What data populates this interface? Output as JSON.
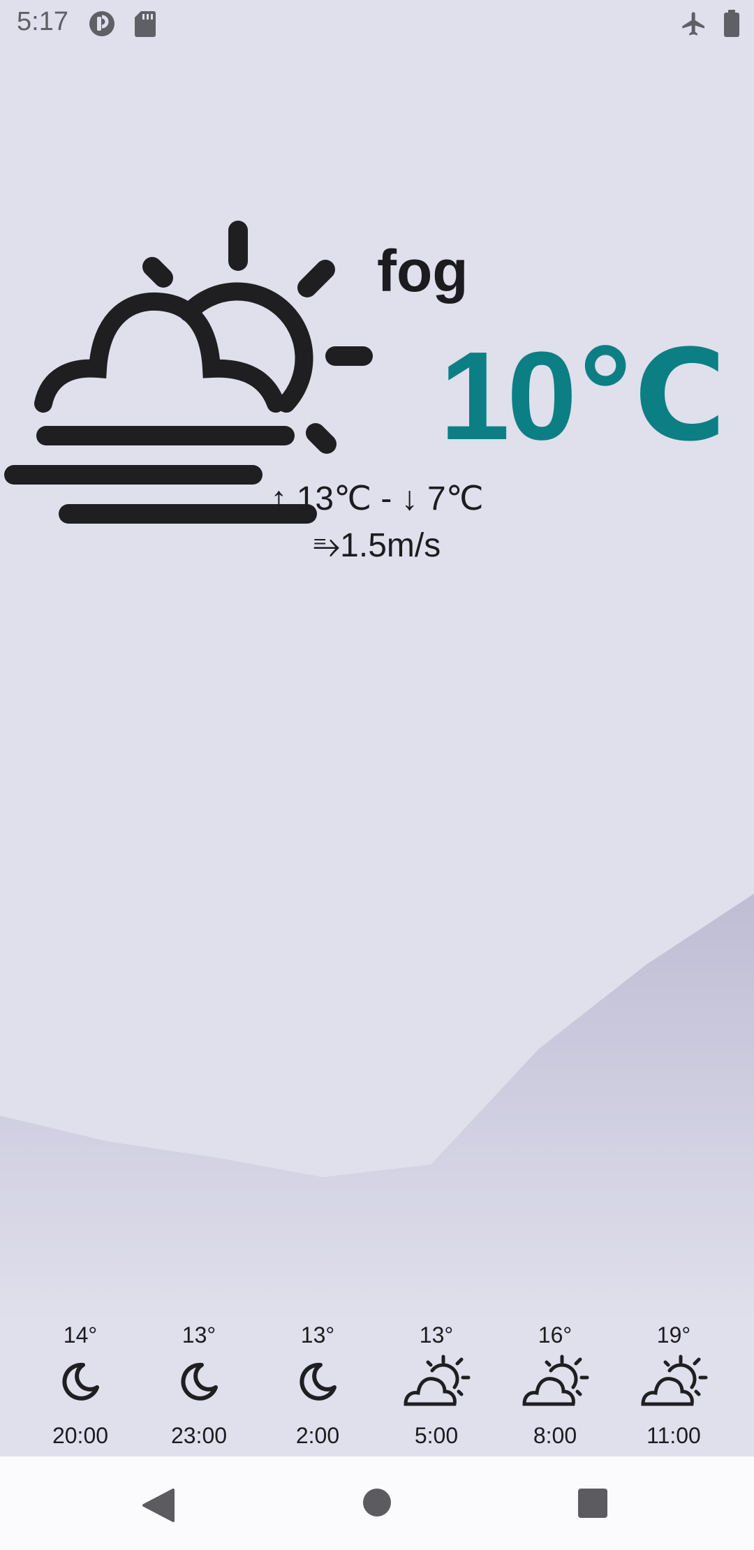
{
  "status_bar": {
    "time": "5:17",
    "left_icons": [
      "notification-app-icon",
      "sd-card-icon"
    ],
    "right_icons": [
      "airplane-mode-icon",
      "battery-icon"
    ]
  },
  "current": {
    "condition": "fog",
    "temperature": "10℃",
    "min_max": "↑ 13℃ - ↓ 7℃",
    "wind": "⥱1.5m/s",
    "icon": "fog-cloud-sun-icon",
    "accent_color": "#0b7f84"
  },
  "forecast": [
    {
      "temp": "14°",
      "time": "20:00",
      "icon": "moon-icon"
    },
    {
      "temp": "13°",
      "time": "23:00",
      "icon": "moon-icon"
    },
    {
      "temp": "13°",
      "time": "2:00",
      "icon": "moon-icon"
    },
    {
      "temp": "13°",
      "time": "5:00",
      "icon": "cloud-sun-icon"
    },
    {
      "temp": "16°",
      "time": "8:00",
      "icon": "cloud-sun-icon"
    },
    {
      "temp": "19°",
      "time": "11:00",
      "icon": "cloud-sun-icon"
    }
  ],
  "nav_bar": {
    "buttons": [
      "back-icon",
      "home-icon",
      "recents-icon"
    ]
  }
}
